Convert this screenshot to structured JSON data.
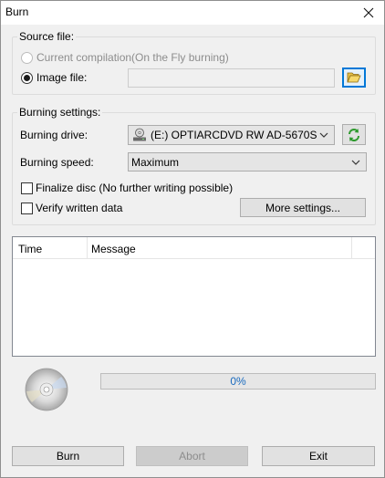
{
  "window": {
    "title": "Burn"
  },
  "source": {
    "group_label": "Source file:",
    "option_compilation": "Current compilation(On the Fly burning)",
    "option_image": "Image file:",
    "image_path": ""
  },
  "settings": {
    "group_label": "Burning settings:",
    "drive_label": "Burning drive:",
    "drive_value": "(E:) OPTIARCDVD RW AD-5670S",
    "speed_label": "Burning speed:",
    "speed_value": "Maximum",
    "finalize_label": "Finalize disc (No further writing possible)",
    "finalize_checked": false,
    "verify_label": "Verify written data",
    "verify_checked": false,
    "more_settings": "More settings..."
  },
  "log": {
    "columns": [
      "Time",
      "Message"
    ],
    "rows": []
  },
  "progress": {
    "percent": 0,
    "text": "0%"
  },
  "buttons": {
    "burn": "Burn",
    "abort": "Abort",
    "exit": "Exit"
  },
  "colors": {
    "accent": "#0078d7",
    "progress_text": "#1a6bbf"
  },
  "icons": {
    "close": "close-icon",
    "browse": "folder-open-icon",
    "drive": "cd-drive-icon",
    "refresh": "refresh-icon",
    "disc": "optical-disc-icon"
  }
}
